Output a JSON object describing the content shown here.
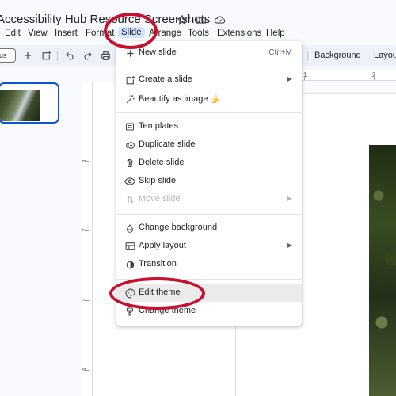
{
  "title": {
    "doc_title": "Accessibility Hub Resource Screenshots",
    "icons": [
      "star-icon",
      "move-to-folder-icon",
      "cloud-saved-icon"
    ]
  },
  "menubar": {
    "items": [
      "Edit",
      "View",
      "Insert",
      "Format",
      "Slide",
      "Arrange",
      "Tools",
      "Extensions",
      "Help"
    ],
    "active": "Slide"
  },
  "toolbar": {
    "zoom_label": "us",
    "background_label": "Background",
    "layout_label": "Layout"
  },
  "ruler": {
    "vertical_numbers": [
      "1",
      "2",
      "3",
      "4"
    ],
    "horizontal_numbers": [
      "1",
      "2"
    ]
  },
  "slide_menu": {
    "new_slide": {
      "label": "New slide",
      "shortcut": "Ctrl+M",
      "icon": "plus-icon"
    },
    "create_slide": {
      "label": "Create a slide",
      "icon": "add-slide-icon"
    },
    "beautify": {
      "label": "Beautify as image",
      "emoji": "🍌",
      "icon": "magic-wand-icon"
    },
    "templates": {
      "label": "Templates",
      "icon": "templates-icon"
    },
    "duplicate": {
      "label": "Duplicate slide",
      "icon": "duplicate-icon"
    },
    "delete": {
      "label": "Delete slide",
      "icon": "trash-icon"
    },
    "skip": {
      "label": "Skip slide",
      "icon": "eye-icon"
    },
    "move": {
      "label": "Move slide",
      "icon": "move-icon"
    },
    "change_bg": {
      "label": "Change background",
      "icon": "paint-drop-icon"
    },
    "apply_layout": {
      "label": "Apply layout",
      "icon": "layout-icon"
    },
    "transition": {
      "label": "Transition",
      "icon": "transition-icon"
    },
    "edit_theme": {
      "label": "Edit theme",
      "icon": "palette-icon"
    },
    "change_theme": {
      "label": "Change theme",
      "icon": "theme-icon"
    }
  },
  "colors": {
    "accent": "#0b57d0",
    "annotation": "#c8102e",
    "highlight": "#ebebeb"
  }
}
